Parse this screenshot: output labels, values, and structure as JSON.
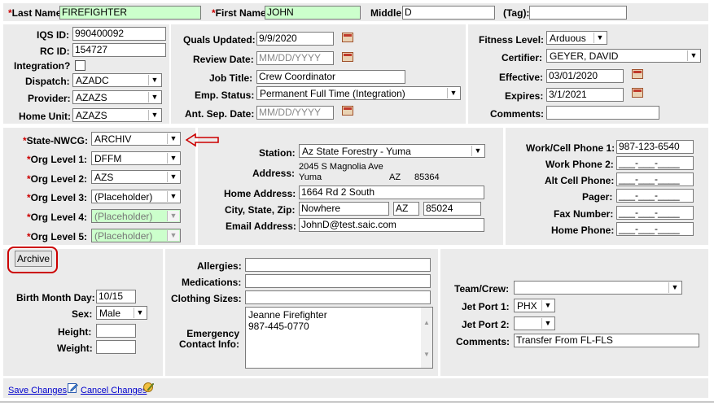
{
  "top": {
    "last_name_label": "Last Name:",
    "last_name": "FIREFIGHTER",
    "first_name_label": "First Name:",
    "first_name": "JOHN",
    "middle_label": "Middle:",
    "middle": "D",
    "tag_label": "(Tag):",
    "tag": ""
  },
  "ids": {
    "iqs_label": "IQS ID:",
    "iqs": "990400092",
    "rc_label": "RC ID:",
    "rc": "154727",
    "integration_label": "Integration?",
    "dispatch_label": "Dispatch:",
    "dispatch": "AZADC",
    "provider_label": "Provider:",
    "provider": "AZAZS",
    "home_unit_label": "Home Unit:",
    "home_unit": "AZAZS"
  },
  "quals": {
    "quals_updated_label": "Quals Updated:",
    "quals_updated": "9/9/2020",
    "review_date_label": "Review Date:",
    "review_date_placeholder": "MM/DD/YYYY",
    "job_title_label": "Job Title:",
    "job_title": "Crew Coordinator",
    "emp_status_label": "Emp. Status:",
    "emp_status": "Permanent Full Time (Integration)",
    "ant_sep_label": "Ant. Sep. Date:",
    "ant_sep_placeholder": "MM/DD/YYYY"
  },
  "fitness": {
    "fitness_level_label": "Fitness Level:",
    "fitness_level": "Arduous",
    "certifier_label": "Certifier:",
    "certifier": "GEYER, DAVID",
    "effective_label": "Effective:",
    "effective": "03/01/2020",
    "expires_label": "Expires:",
    "expires": "3/1/2021",
    "comments_label": "Comments:",
    "comments": ""
  },
  "org": {
    "state_label": "State-NWCG:",
    "state": "ARCHIV",
    "l1_label": "Org Level 1:",
    "l1": "DFFM",
    "l2_label": "Org Level 2:",
    "l2": "AZS",
    "l3_label": "Org Level 3:",
    "l3": "(Placeholder)",
    "l4_label": "Org Level 4:",
    "l4": "(Placeholder)",
    "l5_label": "Org Level 5:",
    "l5": "(Placeholder)"
  },
  "station": {
    "station_label": "Station:",
    "station": "Az State Forestry - Yuma",
    "address_label": "Address:",
    "address_line1": "2045 S Magnolia Ave",
    "address_city": "Yuma",
    "address_state": "AZ",
    "address_zip": "85364",
    "home_address_label": "Home Address:",
    "home_address": "1664 Rd 2 South",
    "csz_label": "City, State, Zip:",
    "city": "Nowhere",
    "state": "AZ",
    "zip": "85024",
    "email_label": "Email Address:",
    "email": "JohnD@test.saic.com"
  },
  "phones": {
    "work_cell_label": "Work/Cell Phone 1:",
    "work_cell": "987-123-6540",
    "work2_label": "Work Phone 2:",
    "work2": "___-___-____",
    "alt_cell_label": "Alt Cell Phone:",
    "alt_cell": "___-___-____",
    "pager_label": "Pager:",
    "pager": "___-___-____",
    "fax_label": "Fax Number:",
    "fax": "___-___-____",
    "home_label": "Home Phone:",
    "home": "___-___-____"
  },
  "personal": {
    "archive_button": "Archive",
    "birth_label": "Birth Month Day:",
    "birth": "10/15",
    "sex_label": "Sex:",
    "sex": "Male",
    "height_label": "Height:",
    "height": "",
    "weight_label": "Weight:",
    "weight": ""
  },
  "medical": {
    "allergies_label": "Allergies:",
    "medications_label": "Medications:",
    "clothing_label": "Clothing Sizes:",
    "emergency_label_1": "Emergency",
    "emergency_label_2": "Contact Info:",
    "emergency_value": "Jeanne Firefighter\n987-445-0770"
  },
  "crew": {
    "team_label": "Team/Crew:",
    "team": "",
    "jet1_label": "Jet Port 1:",
    "jet1": "PHX",
    "jet2_label": "Jet Port 2:",
    "jet2": "",
    "comments_label": "Comments:",
    "comments": "Transfer From FL-FLS"
  },
  "footer": {
    "save": "Save Changes",
    "cancel": "Cancel Changes"
  },
  "colors": {
    "required_bg": "#ccffcc",
    "panel": "#ebebeb",
    "annotation": "#cc0000"
  }
}
